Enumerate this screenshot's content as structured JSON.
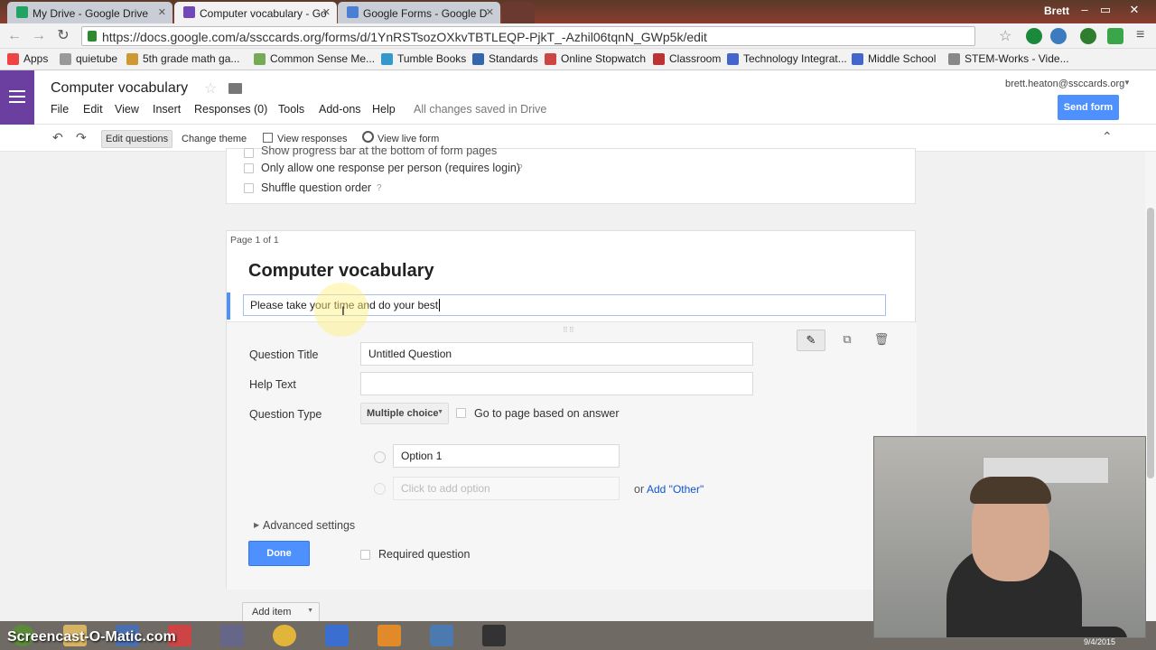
{
  "browser": {
    "tabs": [
      {
        "label": "My Drive - Google Drive"
      },
      {
        "label": "Computer vocabulary - Go"
      },
      {
        "label": "Google Forms - Google D"
      }
    ],
    "user": "Brett",
    "url": "https://docs.google.com/a/ssccards.org/forms/d/1YnRSTsozOXkvTBTLEQP-PjkT_-Azhil06tqnN_GWp5k/edit",
    "bookmarks": [
      "Apps",
      "quietube",
      "5th grade math ga...",
      "Common Sense Me...",
      "Tumble Books",
      "Standards",
      "Online Stopwatch",
      "Classroom",
      "Technology Integrat...",
      "Middle School",
      "STEM-Works - Vide..."
    ]
  },
  "header": {
    "title": "Computer vocabulary",
    "menus": [
      "File",
      "Edit",
      "View",
      "Insert",
      "Responses (0)",
      "Tools",
      "Add-ons",
      "Help"
    ],
    "saved_status": "All changes saved in Drive",
    "account": "brett.heaton@ssccards.org",
    "send_label": "Send form"
  },
  "toolbar": {
    "edit_questions": "Edit questions",
    "change_theme": "Change theme",
    "view_responses": "View responses",
    "view_live_form": "View live form"
  },
  "settings": {
    "progress_bar": "Show progress bar at the bottom of form pages",
    "one_response": "Only allow one response per person (requires login)",
    "shuffle": "Shuffle question order",
    "help_mark": "?"
  },
  "form": {
    "page_label": "Page 1 of 1",
    "title": "Computer vocabulary",
    "description": "Please take your time and do your best"
  },
  "question": {
    "title_label": "Question Title",
    "title_value": "Untitled Question",
    "help_label": "Help Text",
    "help_value": "",
    "type_label": "Question Type",
    "type_value": "Multiple choice",
    "go_to_page": "Go to page based on answer",
    "option1": "Option 1",
    "add_option_placeholder": "Click to add option",
    "or_text": "or",
    "add_other": "Add \"Other\"",
    "advanced": "Advanced settings",
    "done": "Done",
    "required": "Required question"
  },
  "add_item": "Add item",
  "taskbar": {
    "watermark": "Screencast-O-Matic.com",
    "date": "9/4/2015"
  },
  "colors": {
    "accent": "#4d90fe",
    "forms_purple": "#6b3fa0",
    "link": "#1155cc"
  }
}
